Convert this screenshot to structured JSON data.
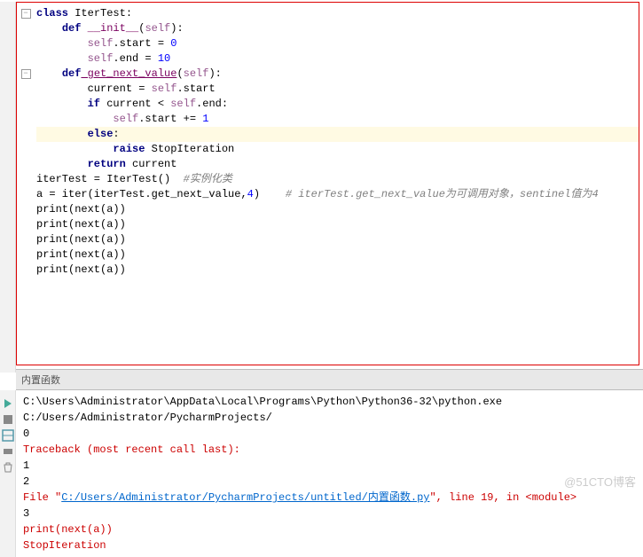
{
  "code": {
    "l1_kw": "class",
    "l1_name": " IterTest",
    "l1_colon": ":",
    "l2_kw": "def",
    "l2_fn": " __init__",
    "l2_p": "(",
    "l2_self": "self",
    "l2_end": "):",
    "l3_self": "self",
    "l3_rest": ".start = ",
    "l3_num": "0",
    "l4_self": "self",
    "l4_rest": ".end = ",
    "l4_num": "10",
    "l5_kw": "def",
    "l5_fn": " get_next_value",
    "l5_p": "(",
    "l5_self": "self",
    "l5_end": "):",
    "l6_a": "current = ",
    "l6_self": "self",
    "l6_b": ".start",
    "l7_kw": "if",
    "l7_a": " current < ",
    "l7_self": "self",
    "l7_b": ".end:",
    "l8_self": "self",
    "l8_a": ".start += ",
    "l8_num": "1",
    "l9_kw": "else",
    "l9_colon": ":",
    "l10_kw": "raise",
    "l10_exc": " StopIteration",
    "l11_kw": "return",
    "l11_rest": " current",
    "l12_a": "iterTest = IterTest()  ",
    "l12_com": "#实例化类",
    "l13_a": "a = iter(iterTest.get_next_value,",
    "l13_num": "4",
    "l13_b": ")    ",
    "l13_com": "# iterTest.get_next_value为可调用对象，sentinel值为4",
    "l14": "print(next(a))",
    "l15": "print(next(a))",
    "l16": "print(next(a))",
    "l17": "print(next(a))",
    "l18": "print(next(a))"
  },
  "panel_title": "内置函数",
  "console": {
    "cmd": "C:\\Users\\Administrator\\AppData\\Local\\Programs\\Python\\Python36-32\\python.exe C:/Users/Administrator/PycharmProjects/",
    "o0": "0",
    "tb": "Traceback (most recent call last):",
    "o1": "1",
    "o2": "2",
    "file_a": "  File \"",
    "file_link": "C:/Users/Administrator/PycharmProjects/untitled/内置函数.py",
    "file_b": "\", line 19, in <module>",
    "o3": "3",
    "call": "    print(next(a))",
    "exc": "StopIteration"
  },
  "watermark": "@51CTO博客"
}
